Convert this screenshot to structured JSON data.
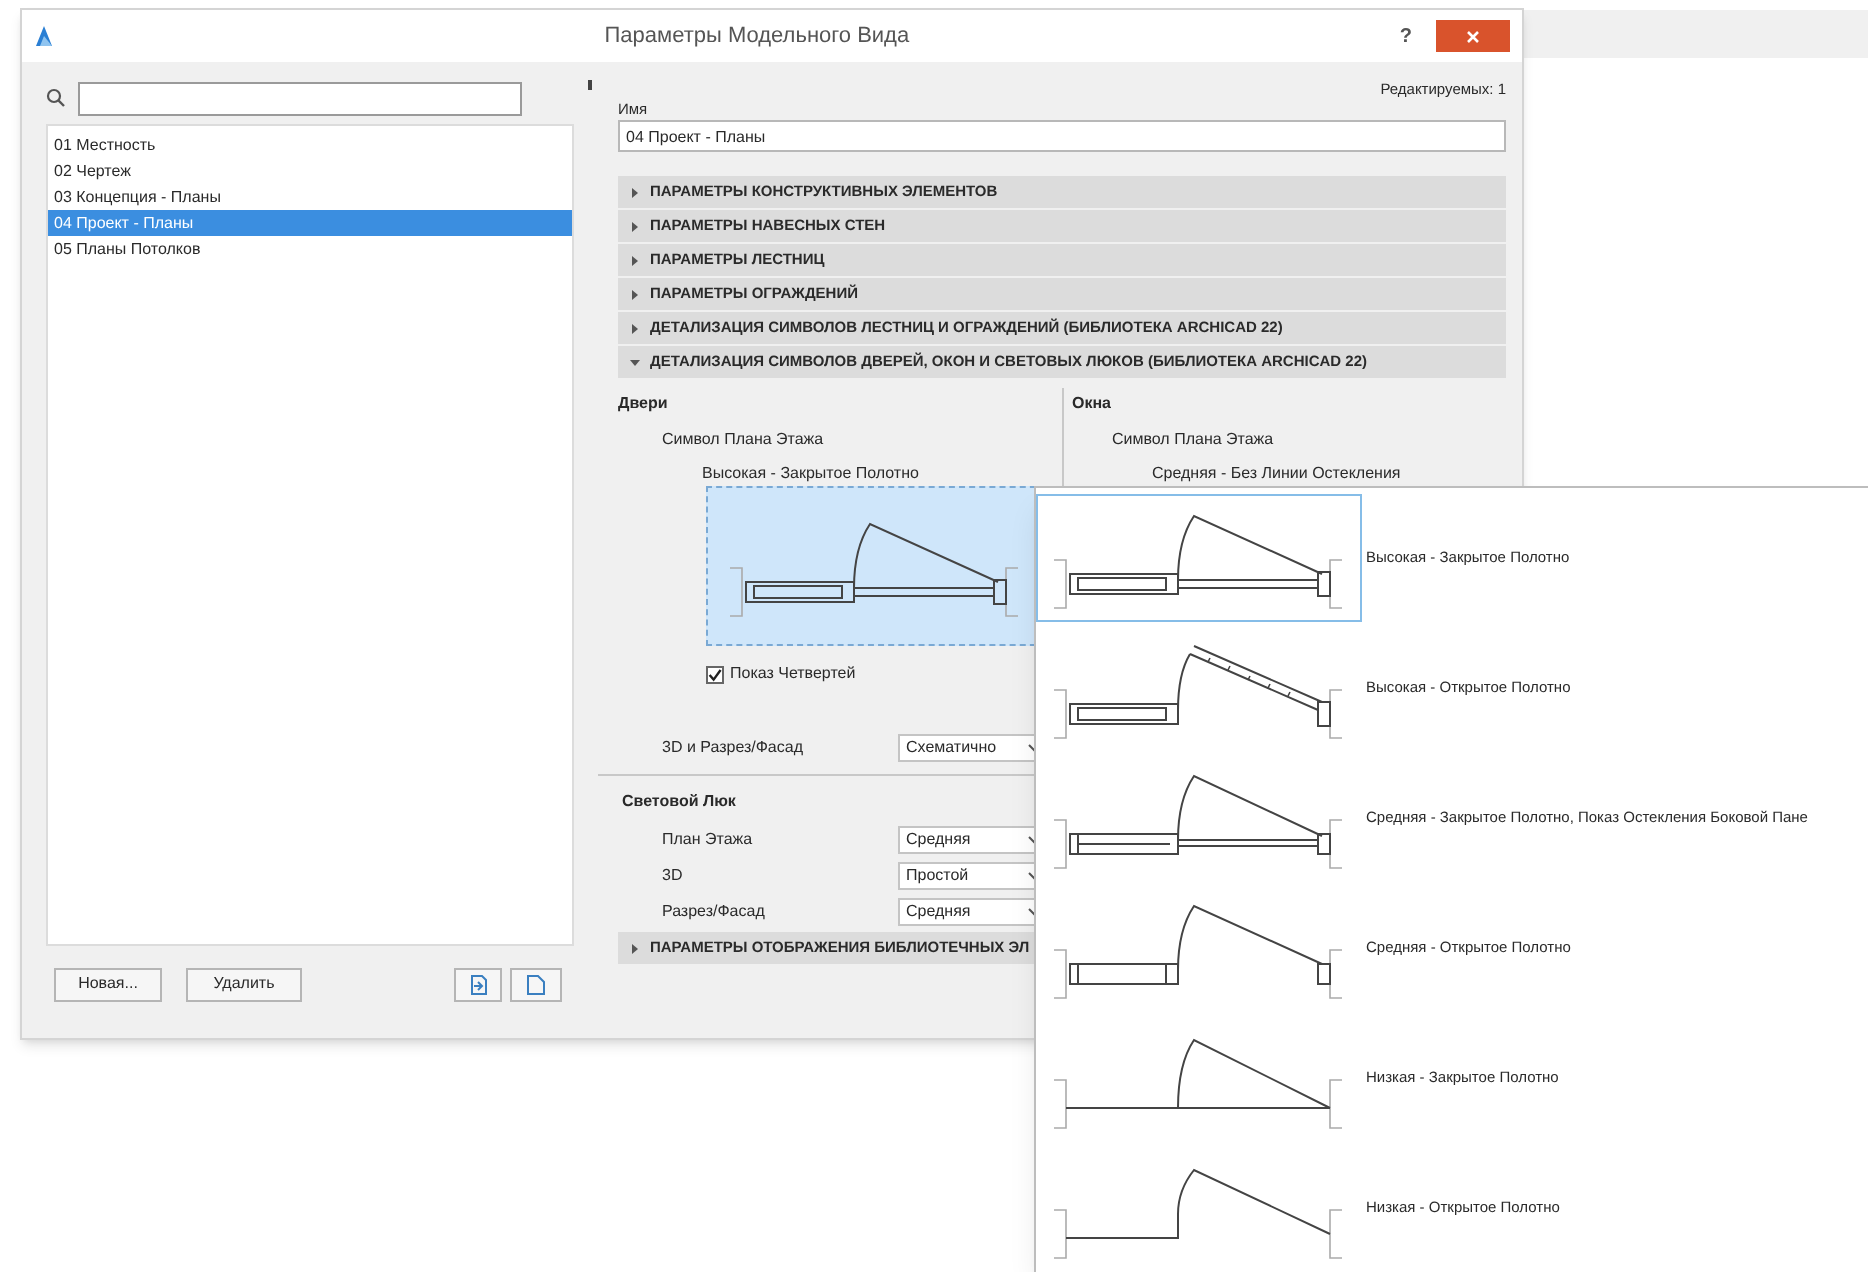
{
  "window": {
    "title": "Параметры Модельного Вида",
    "help": "?"
  },
  "views": [
    {
      "label": "01 Местность",
      "selected": false
    },
    {
      "label": "02 Чертеж",
      "selected": false
    },
    {
      "label": "03 Концепция - Планы",
      "selected": false
    },
    {
      "label": "04 Проект - Планы",
      "selected": true
    },
    {
      "label": "05 Планы Потолков",
      "selected": false
    }
  ],
  "buttons": [
    "Новая...",
    "Удалить"
  ],
  "editable_count": "Редактируемых: 1",
  "name_field": {
    "label": "Имя",
    "value": "04 Проект - Планы"
  },
  "sections": [
    {
      "title": "ПАРАМЕТРЫ КОНСТРУКТИВНЫХ ЭЛЕМЕНТОВ",
      "expanded": false
    },
    {
      "title": "ПАРАМЕТРЫ НАВЕСНЫХ СТЕН",
      "expanded": false
    },
    {
      "title": "ПАРАМЕТРЫ ЛЕСТНИЦ",
      "expanded": false
    },
    {
      "title": "ПАРАМЕТРЫ ОГРАЖДЕНИЙ",
      "expanded": false
    },
    {
      "title": "ДЕТАЛИЗАЦИЯ СИМВОЛОВ ЛЕСТНИЦ И ОГРАЖДЕНИЙ (БИБЛИОТЕКА ARCHICAD 22)",
      "expanded": false
    },
    {
      "title": "ДЕТАЛИЗАЦИЯ СИМВОЛОВ ДВЕРЕЙ, ОКОН И СВЕТОВЫХ ЛЮКОВ (БИБЛИОТЕКА ARCHICAD 22)",
      "expanded": true
    },
    {
      "title": "ПАРАМЕТРЫ ОТОБРАЖЕНИЯ БИБЛИОТЕЧНЫХ ЭЛ",
      "expanded": false
    }
  ],
  "doors": {
    "title": "Двери",
    "floor_plan_label": "Символ Плана Этажа",
    "symbol_name": "Высокая - Закрытое Полотно",
    "kind": "high-closed",
    "quarters": {
      "label": "Показ Четвертей",
      "checked": true
    },
    "section_label": "3D и Разрез/Фасад",
    "section_value": "Схематично"
  },
  "windows": {
    "title": "Окна",
    "floor_plan_label": "Символ Плана Этажа",
    "symbol_name": "Средняя - Без Линии Остекления"
  },
  "skylight": {
    "title": "Световой Люк",
    "rows": [
      {
        "label": "План Этажа",
        "value": "Средняя"
      },
      {
        "label": "3D",
        "value": "Простой"
      },
      {
        "label": "Разрез/Фасад",
        "value": "Средняя"
      }
    ]
  },
  "symbol_popup": {
    "options": [
      {
        "label": "Высокая - Закрытое Полотно",
        "kind": "high-closed",
        "selected": true
      },
      {
        "label": "Высокая - Открытое Полотно",
        "kind": "high-open",
        "selected": false
      },
      {
        "label": "Средняя - Закрытое Полотно, Показ Остекления Боковой Пане",
        "kind": "medium-closed-glass",
        "selected": false
      },
      {
        "label": "Средняя - Открытое Полотно",
        "kind": "medium-open",
        "selected": false
      },
      {
        "label": "Низкая - Закрытое Полотно",
        "kind": "low-closed",
        "selected": false
      },
      {
        "label": "Низкая - Открытое Полотно",
        "kind": "low-open",
        "selected": false
      }
    ]
  }
}
